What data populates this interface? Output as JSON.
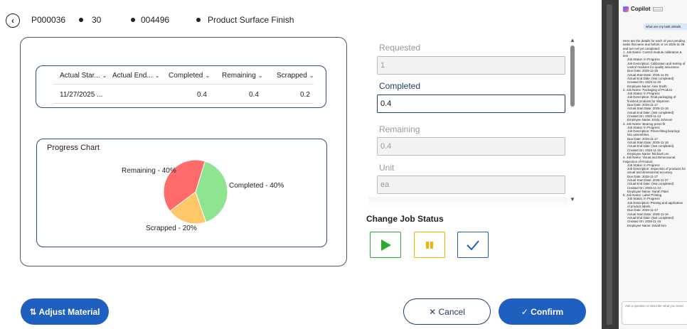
{
  "header": {
    "order_id": "P000036",
    "operation": "30",
    "job_id": "004496",
    "step_name": "Product Surface Finish"
  },
  "table": {
    "columns": [
      "Actual Star...",
      "Actual End...",
      "Completed",
      "Remaining",
      "Scrapped"
    ],
    "rows": [
      {
        "actual_start": "11/27/2025 ...",
        "actual_end": "",
        "completed": "0.4",
        "remaining": "0.4",
        "scrapped": "0.2"
      }
    ]
  },
  "chart_data": {
    "type": "pie",
    "title": "Progress Chart",
    "slices": [
      {
        "label": "Completed - 40%",
        "value": 40,
        "color": "#8fe48f"
      },
      {
        "label": "Scrapped - 20%",
        "value": 20,
        "color": "#ffc766"
      },
      {
        "label": "Remaining - 40%",
        "value": 40,
        "color": "#ff6b6b"
      }
    ]
  },
  "form": {
    "requested_label": "Requested",
    "requested_value": "1",
    "completed_label": "Completed",
    "completed_value": "0.4",
    "remaining_label": "Remaining",
    "remaining_value": "0.4",
    "unit_label": "Unit",
    "unit_value": "ea"
  },
  "status": {
    "title": "Change Job Status",
    "start_color": "#2eaa2e",
    "pause_color": "#f2b200",
    "complete_color": "#1f5fbf"
  },
  "actions": {
    "adjust_label": "⇅ Adjust Material",
    "cancel_label": "✕ Cancel",
    "confirm_label": "✓ Confirm"
  },
  "copilot": {
    "title": "Copilot",
    "badge": "preview",
    "user_message": "what are my task details",
    "intro": "Here are the details for each of your pending tasks that were due before or on 2025-11-28 and are not yet completed:",
    "items": [
      "1. Job Name: Control module calibration & test",
      "Job Status: In Progress",
      "Job Description: Calibration and testing of control modules for quality assurance.",
      "Due Date: 2025-11-26",
      "Actual Start Date: 2025-11-25",
      "Actual End Date: (Not completed)",
      "Created On: 2025-11-20",
      "Employee Name: Alex Smith",
      "2. Job Name: Packaging of Product",
      "Job Status: In Progress",
      "Job Description: Final packaging of finished products for shipment.",
      "Due Date: 2025-11-17",
      "Actual Start Date: 2025-11-16",
      "Actual End Date: (Not completed)",
      "Created On: 2025-11-13",
      "Employee Name: Emily Johnson",
      "3. Job Name: Bearing press-fit",
      "Job Status: In Progress",
      "Job Description: Press-fitting bearings into assemblies.",
      "Due Date: 2025-11-17",
      "Actual Start Date: 2025-11-16",
      "Actual End Date: (Not completed)",
      "Created On: 2025-11-15",
      "Employee Name: Michael Lee",
      "4. Job Name: Visual and Dimensional Inspection of Product",
      "Job Status: In Progress",
      "Job Description: Inspection of products for visual and dimensional accuracy.",
      "Due Date: 2025-11-27",
      "Actual Start Date: 2025-11-27",
      "Actual End Date: (Not completed)",
      "Created On: 2025-11-24",
      "Employee Name: Sarah Patel",
      "5. Job Name: Label Printing",
      "Job Status: In Progress",
      "Job Description: Printing and application of product labels.",
      "Due Date: 2025-11-17",
      "Actual Start Date: 2025-11-16",
      "Actual End Date: (Not completed)",
      "Created On: 2025-11-15",
      "Employee Name: David Kim"
    ],
    "input_placeholder": "Ask a question or describe what you need"
  }
}
